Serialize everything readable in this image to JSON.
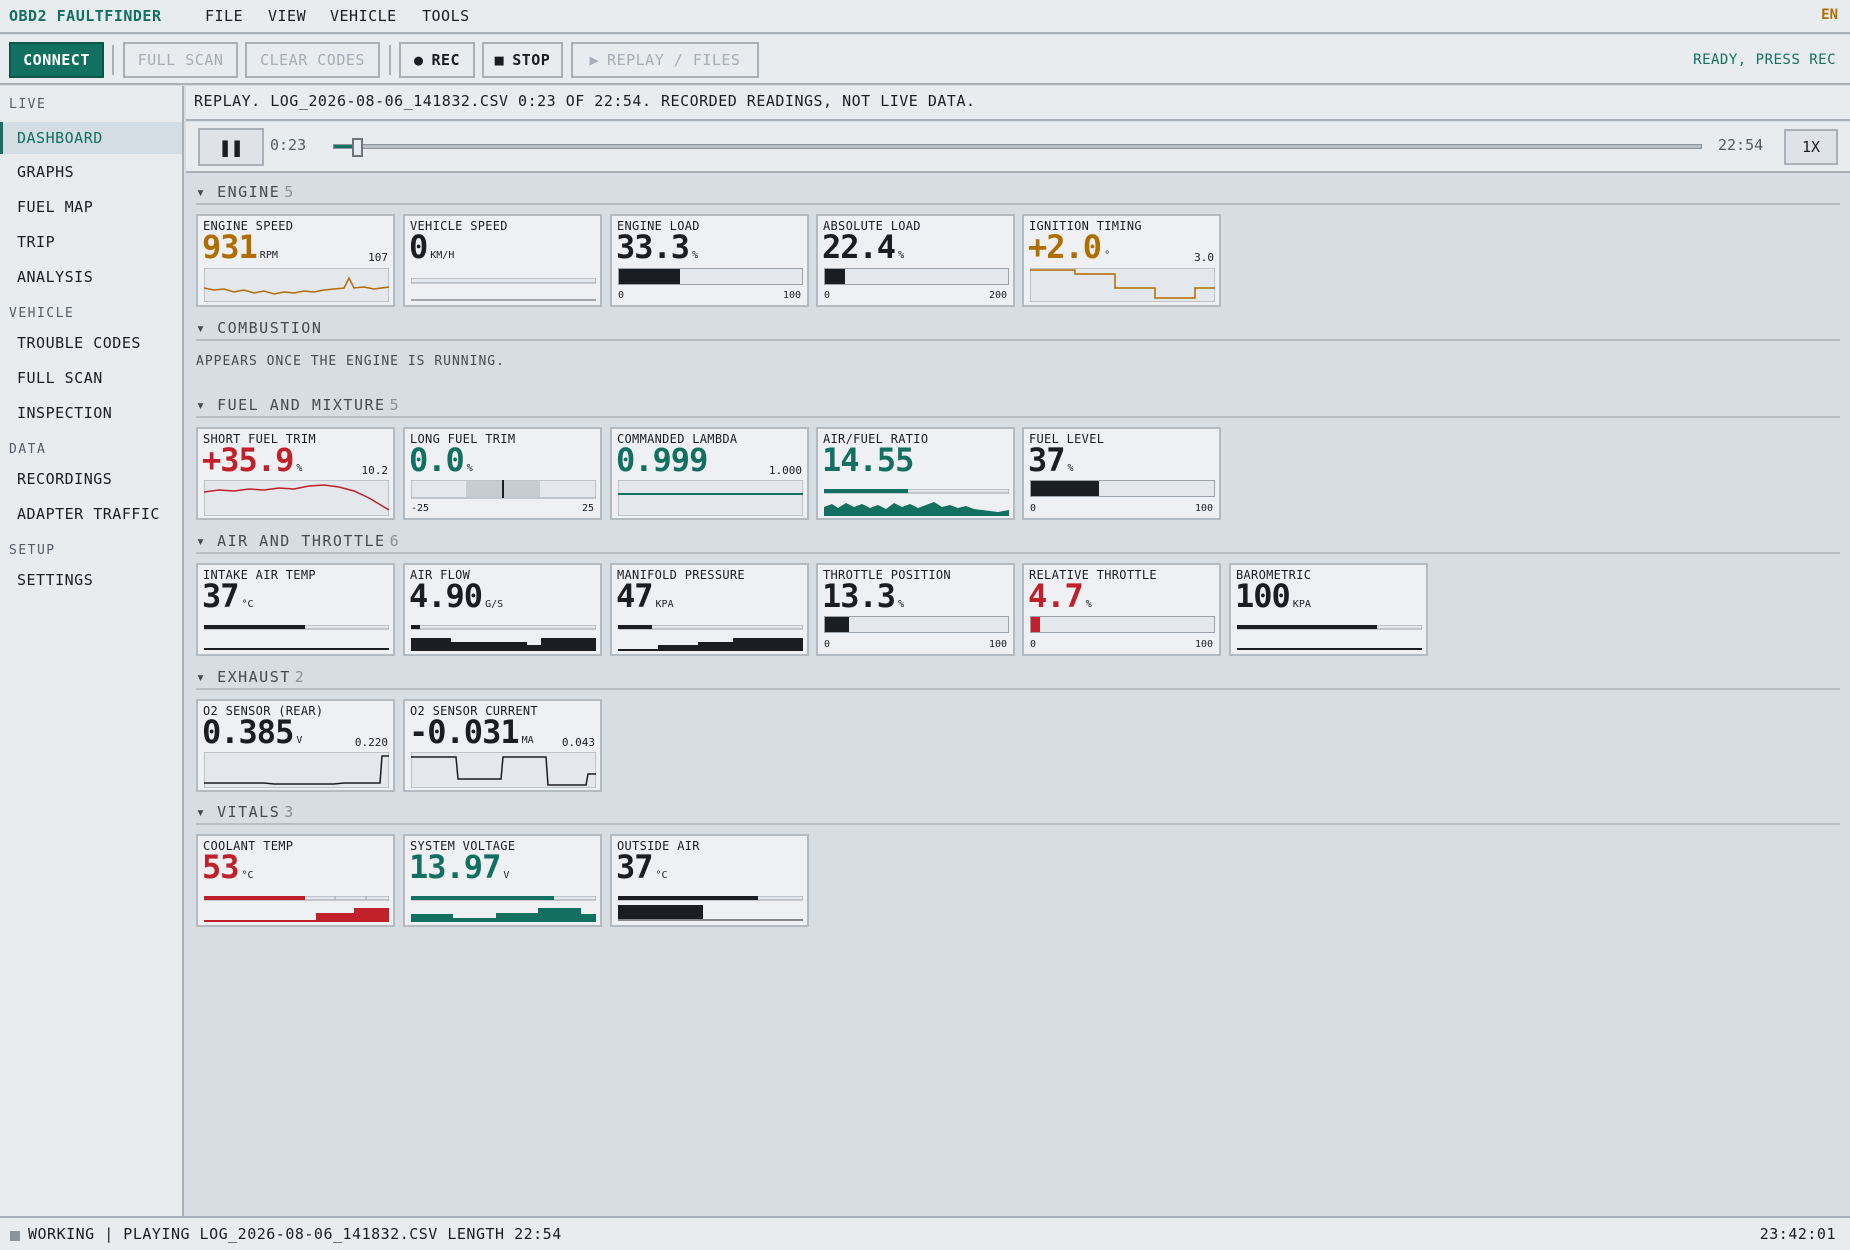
{
  "app": {
    "title": "OBD2 FAULTFINDER",
    "lang": "EN"
  },
  "menu": [
    "FILE",
    "VIEW",
    "VEHICLE",
    "TOOLS"
  ],
  "toolbar": {
    "connect": "CONNECT",
    "full_scan": "FULL SCAN",
    "clear_codes": "CLEAR CODES",
    "rec": "REC",
    "stop": "STOP",
    "replay": "REPLAY / FILES",
    "status": "READY, PRESS REC"
  },
  "sidebar": {
    "sections": [
      {
        "label": "LIVE",
        "items": [
          "DASHBOARD",
          "GRAPHS",
          "FUEL MAP",
          "TRIP",
          "ANALYSIS"
        ]
      },
      {
        "label": "VEHICLE",
        "items": [
          "TROUBLE CODES",
          "FULL SCAN",
          "INSPECTION"
        ]
      },
      {
        "label": "DATA",
        "items": [
          "RECORDINGS",
          "ADAPTER TRAFFIC"
        ]
      },
      {
        "label": "SETUP",
        "items": [
          "SETTINGS"
        ]
      }
    ],
    "active": "DASHBOARD"
  },
  "replay": {
    "banner": "REPLAY. LOG_2026-08-06_141832.CSV 0:23 OF 22:54. RECORDED READINGS, NOT LIVE DATA.",
    "elapsed": "0:23",
    "total": "22:54",
    "progress": 0.017,
    "speed": "1X",
    "pause_icon": "pause-icon"
  },
  "groups": {
    "engine": {
      "label": "ENGINE",
      "count": "5"
    },
    "combustion": {
      "label": "COMBUSTION",
      "placeholder": "APPEARS ONCE THE ENGINE IS RUNNING."
    },
    "fuel": {
      "label": "FUEL AND MIXTURE",
      "count": "5"
    },
    "air": {
      "label": "AIR AND THROTTLE",
      "count": "6"
    },
    "exhaust": {
      "label": "EXHAUST",
      "count": "2"
    },
    "vitals": {
      "label": "VITALS",
      "count": "3"
    }
  },
  "cards": {
    "engine_speed": {
      "title": "ENGINE SPEED",
      "value": "931",
      "unit": "RPM",
      "trend_max": "107"
    },
    "vehicle_speed": {
      "title": "VEHICLE SPEED",
      "value": "0",
      "unit": "KM/H"
    },
    "engine_load": {
      "title": "ENGINE LOAD",
      "value": "33.3",
      "unit": "%",
      "min": "0",
      "max": "100",
      "level": 0.333
    },
    "absolute_load": {
      "title": "ABSOLUTE LOAD",
      "value": "22.4",
      "unit": "%",
      "min": "0",
      "max": "200",
      "level": 0.112
    },
    "ignition_timing": {
      "title": "IGNITION TIMING",
      "value": "+2.0",
      "unit": "°",
      "trend_max": "3.0"
    },
    "short_fuel_trim": {
      "title": "SHORT FUEL TRIM",
      "value": "+35.9",
      "unit": "%",
      "trend_max": "10.2"
    },
    "long_fuel_trim": {
      "title": "LONG FUEL TRIM",
      "value": "0.0",
      "unit": "%",
      "min": "-25",
      "max": "25"
    },
    "commanded_lambda": {
      "title": "COMMANDED LAMBDA",
      "value": "0.999",
      "trend_max": "1.000"
    },
    "air_fuel_ratio": {
      "title": "AIR/FUEL RATIO",
      "value": "14.55"
    },
    "fuel_level": {
      "title": "FUEL LEVEL",
      "value": "37",
      "unit": "%",
      "min": "0",
      "max": "100",
      "level": 0.37
    },
    "intake_air_temp": {
      "title": "INTAKE AIR TEMP",
      "value": "37",
      "unit": "°C"
    },
    "air_flow": {
      "title": "AIR FLOW",
      "value": "4.90",
      "unit": "G/S"
    },
    "manifold_pressure": {
      "title": "MANIFOLD PRESSURE",
      "value": "47",
      "unit": "KPA"
    },
    "throttle_position": {
      "title": "THROTTLE POSITION",
      "value": "13.3",
      "unit": "%",
      "min": "0",
      "max": "100",
      "level": 0.133
    },
    "relative_throttle": {
      "title": "RELATIVE THROTTLE",
      "value": "4.7",
      "unit": "%",
      "min": "0",
      "max": "100",
      "level": 0.047
    },
    "barometric": {
      "title": "BAROMETRIC",
      "value": "100",
      "unit": "KPA"
    },
    "o2_rear": {
      "title": "O2 SENSOR (REAR)",
      "value": "0.385",
      "unit": "V",
      "trend_max": "0.220"
    },
    "o2_current": {
      "title": "O2 SENSOR CURRENT",
      "value": "-0.031",
      "unit": "MA",
      "trend_max": "0.043"
    },
    "coolant_temp": {
      "title": "COOLANT TEMP",
      "value": "53",
      "unit": "°C"
    },
    "system_voltage": {
      "title": "SYSTEM VOLTAGE",
      "value": "13.97",
      "unit": "V"
    },
    "outside_air": {
      "title": "OUTSIDE AIR",
      "value": "37",
      "unit": "°C"
    }
  },
  "footer": {
    "status": "WORKING | PLAYING LOG_2026-08-06_141832.CSV LENGTH 22:54",
    "time": "23:42:01"
  },
  "colors": {
    "accent": "#11705f",
    "warn": "#b06e00",
    "alert": "#c0202a",
    "bg": "#d8dce3"
  }
}
